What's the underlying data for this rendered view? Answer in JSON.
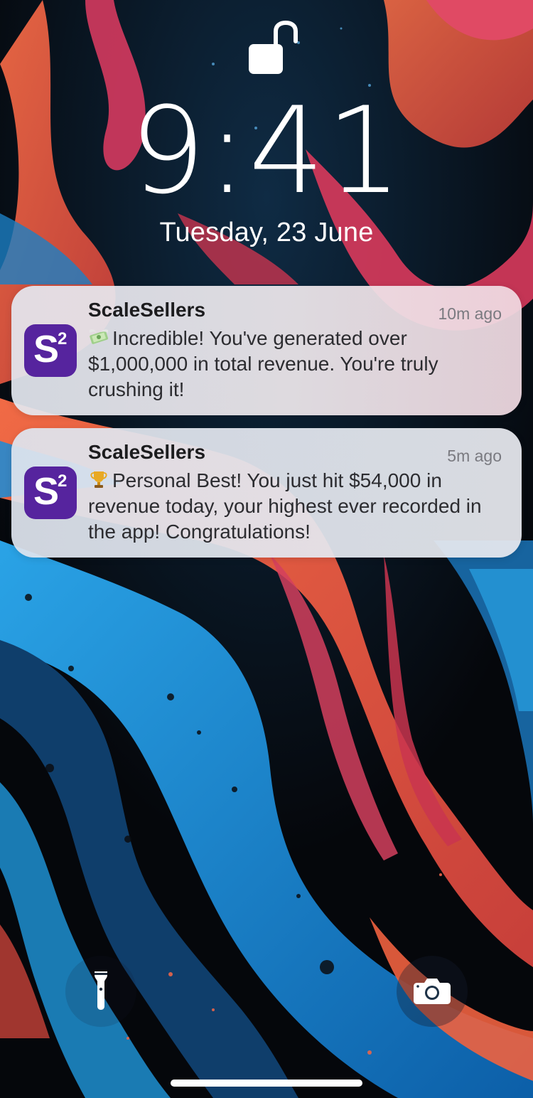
{
  "lock_screen": {
    "time": "9:41",
    "date": "Tuesday,  23 June",
    "lock_icon": "unlocked-padlock-icon"
  },
  "notifications": [
    {
      "app": "ScaleSellers",
      "time_ago": "10m ago",
      "emoji": "money-with-wings-icon",
      "message": "Incredible! You've generated over $1,000,000 in total revenue. You're truly crushing it!",
      "app_icon_letter": "S",
      "app_icon_superscript": "2",
      "app_icon_color": "#56249e"
    },
    {
      "app": "ScaleSellers",
      "time_ago": "5m ago",
      "emoji": "trophy-icon",
      "message": "Personal Best! You just hit $54,000 in revenue today, your highest ever recorded in the app! Congratulations!",
      "app_icon_letter": "S",
      "app_icon_superscript": "2",
      "app_icon_color": "#56249e"
    }
  ],
  "quick_actions": {
    "left": "flashlight-icon",
    "right": "camera-icon"
  },
  "colors": {
    "wallpaper_black": "#05070b",
    "wallpaper_blue": "#1a8fd6",
    "wallpaper_orange": "#e4583e",
    "wallpaper_pink": "#d83a63",
    "notification_bg": "#ececf0"
  }
}
